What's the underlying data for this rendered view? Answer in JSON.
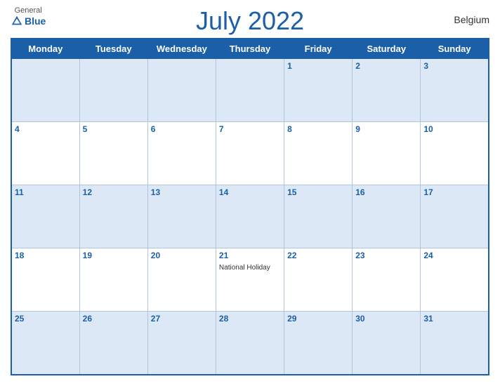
{
  "header": {
    "logo": {
      "general": "General",
      "blue": "Blue"
    },
    "title": "July 2022",
    "country": "Belgium"
  },
  "calendar": {
    "weekdays": [
      "Monday",
      "Tuesday",
      "Wednesday",
      "Thursday",
      "Friday",
      "Saturday",
      "Sunday"
    ],
    "weeks": [
      [
        {
          "day": "",
          "empty": true
        },
        {
          "day": "",
          "empty": true
        },
        {
          "day": "",
          "empty": true
        },
        {
          "day": "",
          "empty": true
        },
        {
          "day": "1",
          "empty": false
        },
        {
          "day": "2",
          "empty": false
        },
        {
          "day": "3",
          "empty": false
        }
      ],
      [
        {
          "day": "4",
          "empty": false
        },
        {
          "day": "5",
          "empty": false
        },
        {
          "day": "6",
          "empty": false
        },
        {
          "day": "7",
          "empty": false
        },
        {
          "day": "8",
          "empty": false
        },
        {
          "day": "9",
          "empty": false
        },
        {
          "day": "10",
          "empty": false
        }
      ],
      [
        {
          "day": "11",
          "empty": false
        },
        {
          "day": "12",
          "empty": false
        },
        {
          "day": "13",
          "empty": false
        },
        {
          "day": "14",
          "empty": false
        },
        {
          "day": "15",
          "empty": false
        },
        {
          "day": "16",
          "empty": false
        },
        {
          "day": "17",
          "empty": false
        }
      ],
      [
        {
          "day": "18",
          "empty": false
        },
        {
          "day": "19",
          "empty": false
        },
        {
          "day": "20",
          "empty": false
        },
        {
          "day": "21",
          "empty": false,
          "event": "National Holiday"
        },
        {
          "day": "22",
          "empty": false
        },
        {
          "day": "23",
          "empty": false
        },
        {
          "day": "24",
          "empty": false
        }
      ],
      [
        {
          "day": "25",
          "empty": false
        },
        {
          "day": "26",
          "empty": false
        },
        {
          "day": "27",
          "empty": false
        },
        {
          "day": "28",
          "empty": false
        },
        {
          "day": "29",
          "empty": false
        },
        {
          "day": "30",
          "empty": false
        },
        {
          "day": "31",
          "empty": false
        }
      ]
    ]
  }
}
